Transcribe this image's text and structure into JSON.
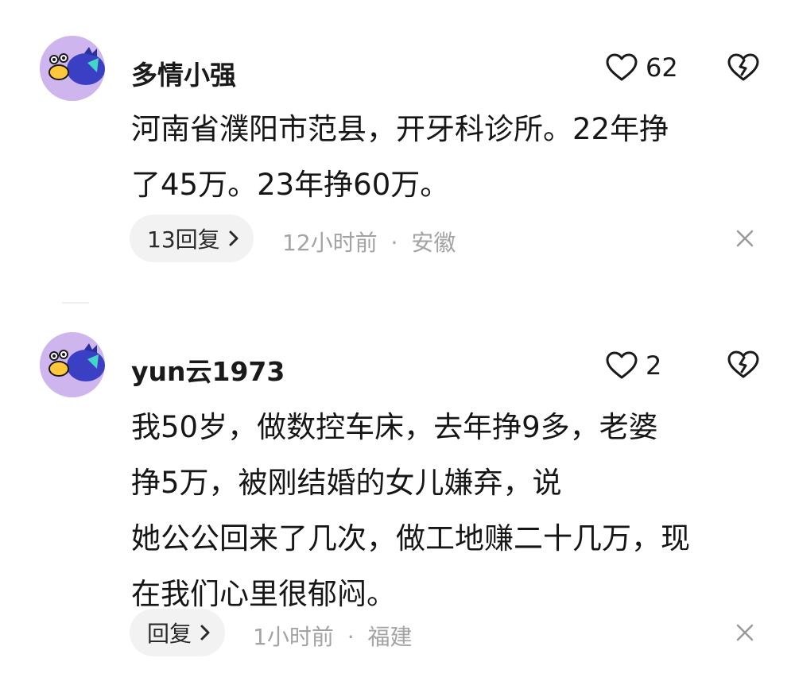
{
  "comments": [
    {
      "username": "多情小强",
      "likes": "62",
      "text_lines": [
        "河南省濮阳市范县，开牙科诊所。22年挣",
        "了45万。23年挣60万。"
      ],
      "reply_label": "13回复",
      "time": "12小时前",
      "separator": "·",
      "location": "安徽"
    },
    {
      "username": "yun云1973",
      "likes": "2",
      "text_lines": [
        "我50岁，做数控车床，去年挣9多，老婆",
        "挣5万，被刚结婚的女儿嫌弃，说",
        "她公公回来了几次，做工地赚二十几万，现",
        "在我们心里很郁闷。"
      ],
      "reply_label": "回复",
      "time": "1小时前",
      "separator": "·",
      "location": "福建"
    }
  ],
  "icons": {
    "like": "heart-outline-icon",
    "dislike": "broken-heart-icon",
    "reply_arrow": "chevron-right-icon",
    "close": "close-icon"
  },
  "colors": {
    "avatar_bg": "#cfb5ee",
    "pill_bg": "#f2f2f2",
    "meta_text": "#a3a3a3"
  }
}
